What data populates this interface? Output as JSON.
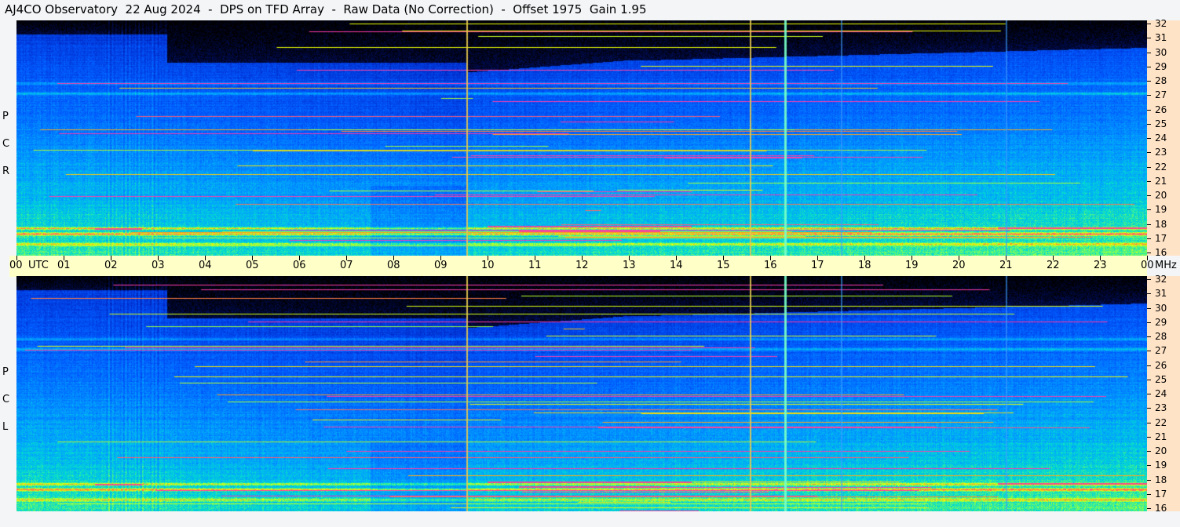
{
  "title": "AJ4CO Observatory  22 Aug 2024  -  DPS on TFD Array  -  Raw Data (No Correction)  -  Offset 1975  Gain 1.95",
  "chart_data": {
    "type": "heatmap",
    "title": "AJ4CO Observatory  22 Aug 2024  -  DPS on TFD Array  -  Raw Data (No Correction)  -  Offset 1975  Gain 1.95",
    "x_axis": {
      "unit_label": "UTC",
      "range_hours": [
        0,
        24
      ],
      "tick_labels": [
        "00",
        "01",
        "02",
        "03",
        "04",
        "05",
        "06",
        "07",
        "08",
        "09",
        "10",
        "11",
        "12",
        "13",
        "14",
        "15",
        "16",
        "17",
        "18",
        "19",
        "20",
        "21",
        "22",
        "23",
        "00"
      ]
    },
    "y_axis": {
      "unit_label": "MHz",
      "range_mhz": [
        16,
        32
      ],
      "tick_labels": [
        "16",
        "17",
        "18",
        "19",
        "20",
        "21",
        "22",
        "23",
        "24",
        "25",
        "26",
        "27",
        "28",
        "29",
        "30",
        "31",
        "32"
      ]
    },
    "panels": [
      {
        "polarization": "RCP",
        "letters": [
          "P",
          "C",
          "R"
        ]
      },
      {
        "polarization": "LCP",
        "letters": [
          "P",
          "C",
          "L"
        ]
      }
    ],
    "features": {
      "vertical_interference_lines_utc": [
        9.55,
        15.57,
        16.3
      ],
      "sun_hours_utc": [
        9.55,
        24.0
      ],
      "colormap": [
        "#000000",
        "#001a8c",
        "#0050ff",
        "#00a0ff",
        "#00e0c0",
        "#a0ff40",
        "#ffff00",
        "#ff4080"
      ]
    }
  }
}
